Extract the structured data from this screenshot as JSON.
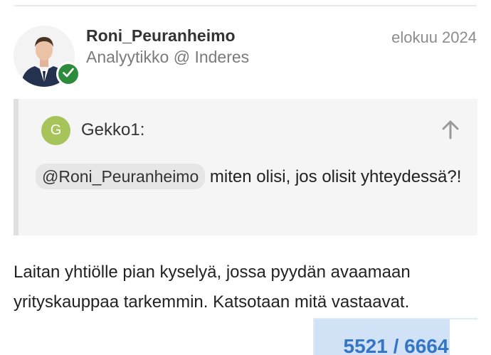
{
  "post": {
    "author": {
      "username": "Roni_Peuranheimo",
      "title": "Analyytikko @ Inderes",
      "avatar_icon": "user-avatar-photo",
      "verified_icon": "check-icon",
      "verified_color": "#2e8b3c"
    },
    "date": "elokuu 2024",
    "quote": {
      "author_initial": "G",
      "author": "Gekko1:",
      "avatar_color": "#a6c45a",
      "expand_icon": "arrow-up-icon",
      "mention": "@Roni_Peuranheimo",
      "text": " miten olisi, jos olisit yhteydessä?!"
    },
    "body": "Laitan yhtiölle pian kyselyä, jossa pyydän avaamaan yrityskauppaa tarkemmin. Katsotaan mitä vastaavat."
  },
  "timeline": {
    "current": 5521,
    "total": 6664,
    "label": "5521 / 6664",
    "accent": "#3575c6"
  }
}
